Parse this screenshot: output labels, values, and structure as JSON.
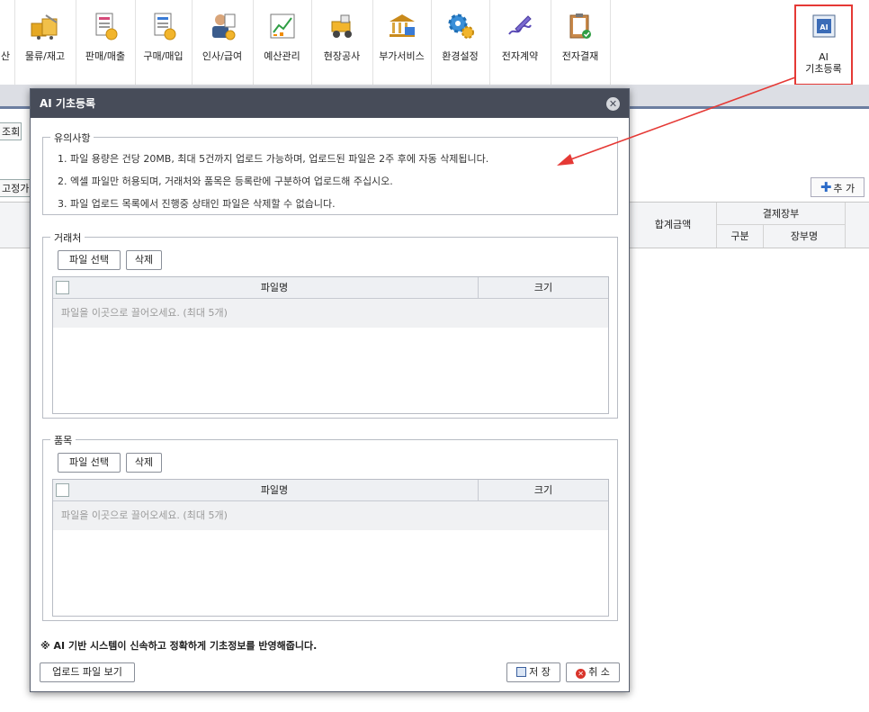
{
  "toolbar": {
    "items": [
      {
        "label": "산"
      },
      {
        "label": "물류/재고"
      },
      {
        "label": "판매/매출"
      },
      {
        "label": "구매/매입"
      },
      {
        "label": "인사/급여"
      },
      {
        "label": "예산관리"
      },
      {
        "label": "현장공사"
      },
      {
        "label": "부가서비스"
      },
      {
        "label": "환경설정"
      },
      {
        "label": "전자계약"
      },
      {
        "label": "전자결재"
      }
    ],
    "ai": {
      "line1": "AI",
      "line2": "기초등록",
      "icon_text": "AI"
    },
    "ai_highlight_color": "#e53935"
  },
  "background": {
    "search_button": "조회",
    "fixed_label": "고정가",
    "add_button": "추 가",
    "grid": {
      "total_amount": "합계금액",
      "payment_ledger": "결제장부",
      "category": "구분",
      "ledger_name": "장부명"
    }
  },
  "modal": {
    "title": "AI 기초등록",
    "notice": {
      "legend": "유의사항",
      "lines": [
        "1. 파일 용량은 건당 20MB, 최대 5건까지 업로드 가능하며, 업로드된 파일은 2주 후에 자동 삭제됩니다.",
        "2. 엑셀 파일만 허용되며, 거래처와 품목은 등록란에 구분하여 업로드해 주십시오.",
        "3. 파일 업로드 목록에서 진행중 상태인 파일은 삭제할 수 없습니다."
      ]
    },
    "customer": {
      "legend": "거래처",
      "select_button": "파일 선택",
      "delete_button": "삭제",
      "col_filename": "파일명",
      "col_size": "크기",
      "empty_text": "파일을 이곳으로 끌어오세요. (최대 5개)"
    },
    "item": {
      "legend": "품목",
      "select_button": "파일 선택",
      "delete_button": "삭제",
      "col_filename": "파일명",
      "col_size": "크기",
      "empty_text": "파일을 이곳으로 끌어오세요. (최대 5개)"
    },
    "footnote": "※ AI 기반 시스템이 신속하고 정확하게 기초정보를 반영해줍니다.",
    "view_files_button": "업로드 파일 보기",
    "save_button": "저 장",
    "cancel_button": "취 소",
    "header_color": "#474c59"
  },
  "annotation": {
    "arrow_color": "#e53935"
  }
}
